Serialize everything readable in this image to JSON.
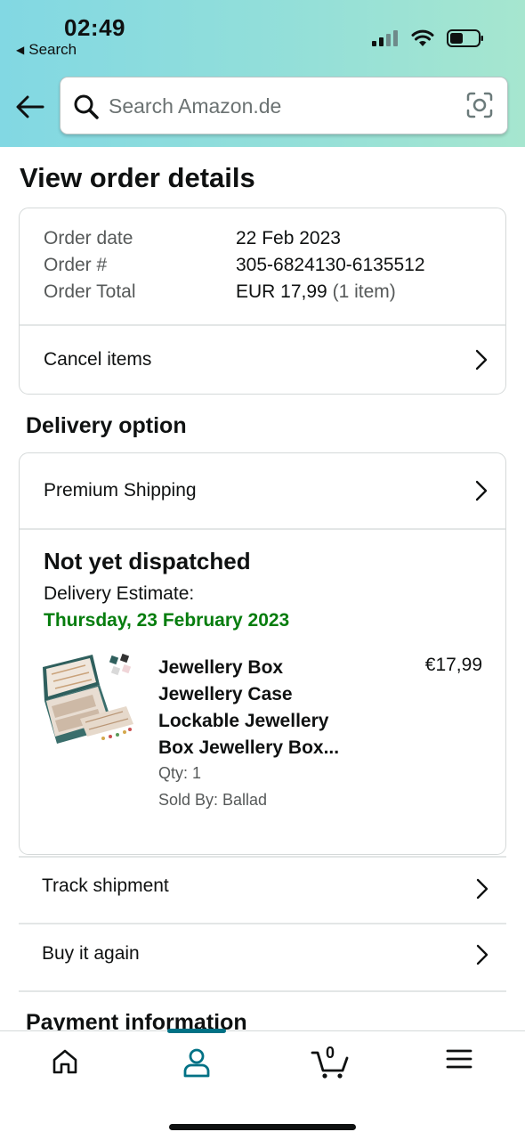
{
  "status_bar": {
    "time": "02:49",
    "back_label": "Search"
  },
  "search": {
    "placeholder": "Search Amazon.de"
  },
  "page_title": "View order details",
  "order_summary": {
    "rows": [
      {
        "label": "Order date",
        "value": "22 Feb 2023",
        "extra": ""
      },
      {
        "label": "Order #",
        "value": "305-6824130-6135512",
        "extra": ""
      },
      {
        "label": "Order Total",
        "value": "EUR 17,99",
        "extra": "(1 item)"
      }
    ],
    "cancel_label": "Cancel items"
  },
  "delivery": {
    "section_title": "Delivery option",
    "shipping_label": "Premium Shipping",
    "status": "Not yet dispatched",
    "estimate_label": "Delivery Estimate:",
    "estimate_date": "Thursday, 23 February 2023",
    "estimate_color": "#067d0e",
    "product": {
      "title_lines": [
        "Jewellery Box",
        "Jewellery Case",
        "Lockable Jewellery",
        "Box Jewellery Box..."
      ],
      "price": "€17,99",
      "qty": "Qty: 1",
      "sold_by": "Sold By: Ballad"
    }
  },
  "actions": {
    "track_label": "Track shipment",
    "buy_again_label": "Buy it again"
  },
  "payment": {
    "section_title": "Payment information"
  },
  "tabbar": {
    "items": [
      "home-icon",
      "account-icon",
      "cart-icon",
      "menu-icon"
    ],
    "cart_count": "0",
    "active_color": "#007185"
  }
}
